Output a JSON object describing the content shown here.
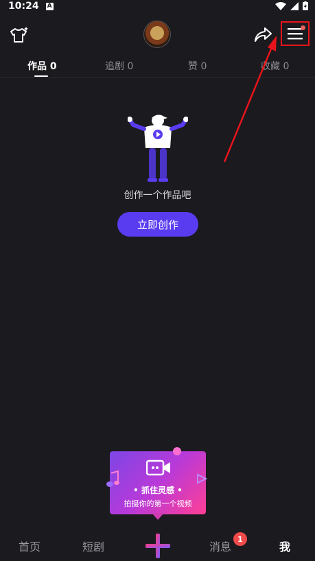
{
  "status_bar": {
    "time": "10:24",
    "notification_letter": "A"
  },
  "tabs": [
    {
      "label": "作品 0"
    },
    {
      "label": "追剧 0"
    },
    {
      "label": "赞 0"
    },
    {
      "label": "收藏 0"
    }
  ],
  "empty_state": {
    "message": "创作一个作品吧",
    "button_label": "立即创作"
  },
  "promo": {
    "title": "• 抓住灵感 •",
    "subtitle": "拍摄你的第一个视频"
  },
  "bottom_nav": {
    "home": "首页",
    "short_drama": "短剧",
    "messages": "消息",
    "messages_badge": "1",
    "me": "我"
  },
  "colors": {
    "accent": "#5a3cf0",
    "highlight_box": "#e8141b",
    "badge": "#f04a4a"
  }
}
